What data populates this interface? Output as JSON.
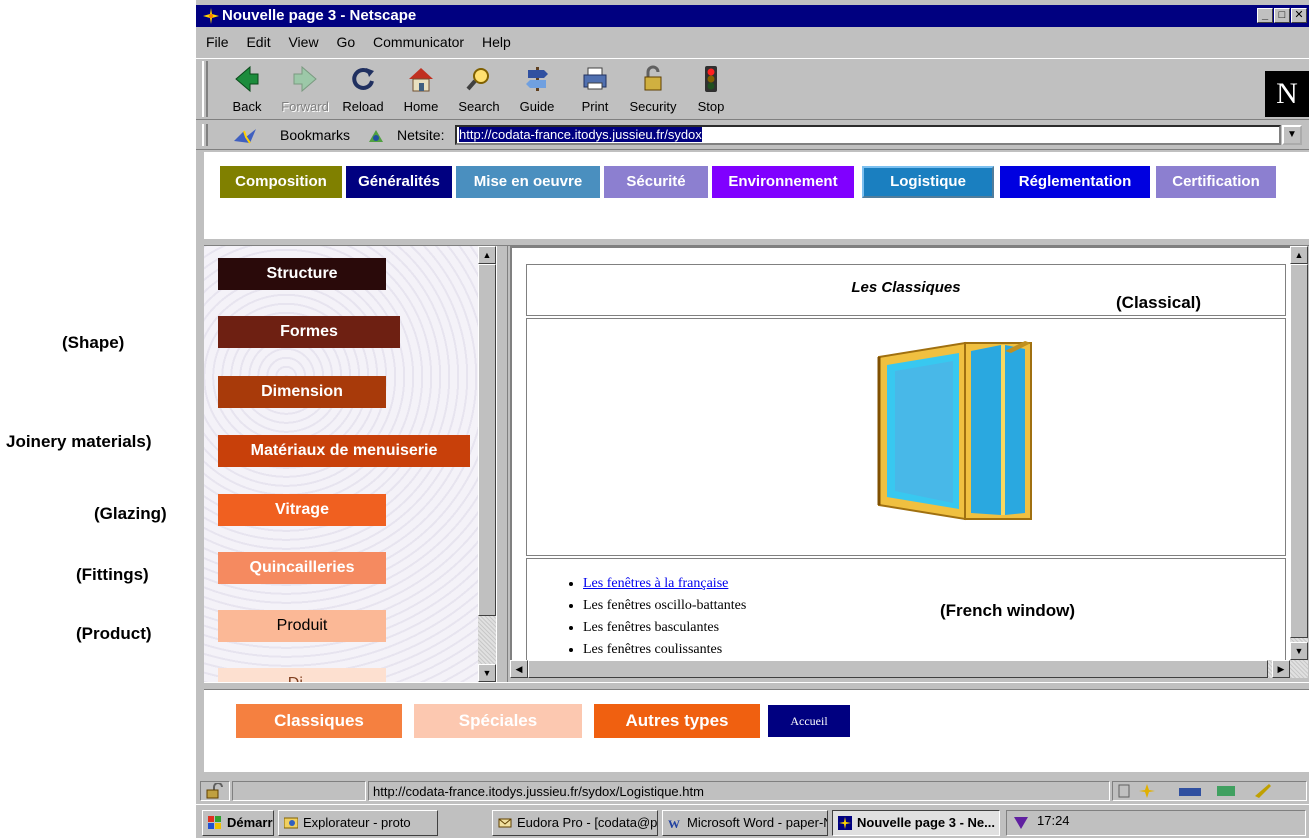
{
  "annotations": {
    "shape": "(Shape)",
    "joinery": "Joinery materials)",
    "glazing": "(Glazing)",
    "fittings": "(Fittings)",
    "product": "(Product)",
    "classical": "(Classical)",
    "french_window": "(French window)"
  },
  "window": {
    "title": "Nouvelle page 3 - Netscape",
    "controls": {
      "minimize": "_",
      "maximize": "□",
      "close": "✕"
    }
  },
  "menu": [
    "File",
    "Edit",
    "View",
    "Go",
    "Communicator",
    "Help"
  ],
  "toolbar": {
    "back": "Back",
    "forward": "Forward",
    "reload": "Reload",
    "home": "Home",
    "search": "Search",
    "guide": "Guide",
    "print": "Print",
    "security": "Security",
    "stop": "Stop",
    "logo": "N"
  },
  "location": {
    "bookmarks": "Bookmarks",
    "netsite_label": "Netsite:",
    "url": "http://codata-france.itodys.jussieu.fr/sydox"
  },
  "top_nav": [
    {
      "label": "Composition",
      "color": "#808000"
    },
    {
      "label": "Généralités",
      "color": "#000080"
    },
    {
      "label": "Mise en oeuvre",
      "color": "#4a8fbf"
    },
    {
      "label": "Sécurité",
      "color": "#8c7fd0"
    },
    {
      "label": "Environnement",
      "color": "#8000ff"
    },
    {
      "label": "Logistique",
      "color": "#1a7fc0"
    },
    {
      "label": "Réglementation",
      "color": "#0000e0"
    },
    {
      "label": "Certification",
      "color": "#8c7fd0"
    }
  ],
  "side_nav": [
    {
      "label": "Structure",
      "color": "#2a0a0a"
    },
    {
      "label": "Formes",
      "color": "#6e2012"
    },
    {
      "label": "Dimension",
      "color": "#a83a0a"
    },
    {
      "label": "Matériaux de menuiserie",
      "color": "#c8400a"
    },
    {
      "label": "Vitrage",
      "color": "#f06020"
    },
    {
      "label": "Quincailleries",
      "color": "#f58a60"
    },
    {
      "label": "Produit",
      "color": "#fbb896"
    },
    {
      "label": "Di...",
      "color": "#fde0d0"
    }
  ],
  "main": {
    "title": "Les Classiques",
    "list": [
      "Les fenêtres à la française",
      "Les fenêtres oscillo-battantes",
      "Les fenêtres basculantes",
      "Les fenêtres coulissantes"
    ]
  },
  "bottom_nav": [
    {
      "label": "Classiques",
      "color": "#f58040"
    },
    {
      "label": "Spéciales",
      "color": "#fcc8b0"
    },
    {
      "label": "Autres types",
      "color": "#f06010"
    },
    {
      "label": "Accueil",
      "color": "#000080"
    }
  ],
  "status": {
    "url": "http://codata-france.itodys.jussieu.fr/sydox/Logistique.htm"
  },
  "taskbar": {
    "start": "Démarrer",
    "items": [
      "Explorateur - proto",
      "Eudora Pro - [codata@pari...",
      "Microsoft Word - paper-Ne...",
      "Nouvelle page 3 - Ne..."
    ],
    "clock": "17:24"
  }
}
